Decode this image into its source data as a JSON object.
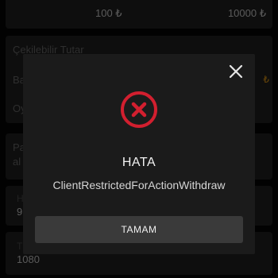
{
  "background": {
    "limits": {
      "min_value": "100 ₺",
      "max_value": "10000 ₺"
    },
    "withdrawable_label": "Çekilebilir Tutar",
    "row_label_1": "Ba",
    "row_label_2": "Oy",
    "currency_symbol": "₺",
    "payment_label_1": "Pa",
    "payment_label_2": "al",
    "field_label": "H",
    "field_value": "9",
    "amount_label": "T",
    "amount_value": "1080"
  },
  "dialog": {
    "title": "HATA",
    "message": "ClientRestrictedForActionWithdraw",
    "ok_label": "TAMAM",
    "icon": "error-x-circle",
    "accent_color": "#d21f2f"
  }
}
